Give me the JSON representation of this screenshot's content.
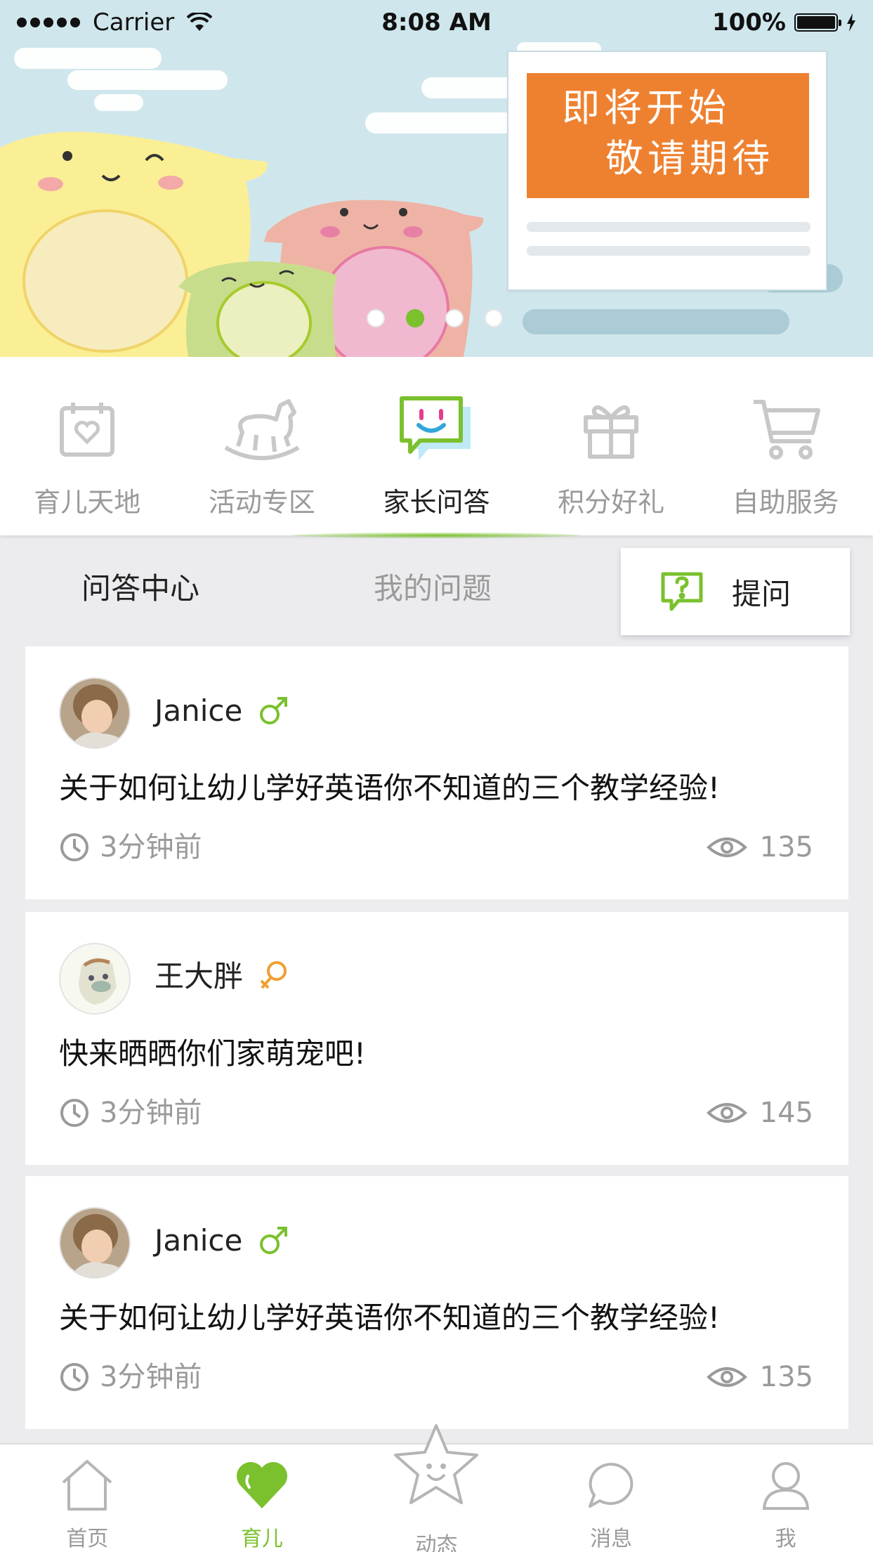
{
  "status_bar": {
    "carrier": "Carrier",
    "time": "8:08 AM",
    "battery": "100%"
  },
  "banner": {
    "notice_line1": "即将开始",
    "notice_line2": "敬请期待",
    "slides": 4,
    "active_slide": 2
  },
  "categories": [
    {
      "label": "育儿天地",
      "icon": "calendar-heart-icon"
    },
    {
      "label": "活动专区",
      "icon": "rocking-horse-icon"
    },
    {
      "label": "家长问答",
      "icon": "chat-smile-icon",
      "active": true
    },
    {
      "label": "积分好礼",
      "icon": "gift-icon"
    },
    {
      "label": "自助服务",
      "icon": "cart-icon"
    }
  ],
  "tabs": {
    "qa_center": "问答中心",
    "my_questions": "我的问题",
    "ask": "提问"
  },
  "questions": [
    {
      "author": "Janice",
      "gender": "male",
      "title": "关于如何让幼儿学好英语你不知道的三个教学经验!",
      "time": "3分钟前",
      "views": "135"
    },
    {
      "author": "王大胖",
      "gender": "female",
      "title": "快来晒晒你们家萌宠吧!",
      "time": "3分钟前",
      "views": "145"
    },
    {
      "author": "Janice",
      "gender": "male",
      "title": "关于如何让幼儿学好英语你不知道的三个教学经验!",
      "time": "3分钟前",
      "views": "135"
    }
  ],
  "bottom_nav": [
    {
      "label": "首页",
      "icon": "home-icon"
    },
    {
      "label": "育儿",
      "icon": "heart-icon",
      "active": true
    },
    {
      "label": "动态",
      "icon": "star-icon"
    },
    {
      "label": "消息",
      "icon": "message-icon"
    },
    {
      "label": "我",
      "icon": "user-icon"
    }
  ],
  "colors": {
    "accent": "#7ac12d",
    "notice": "#ee8130",
    "female": "#f0a030",
    "muted": "#9a9a9a"
  }
}
